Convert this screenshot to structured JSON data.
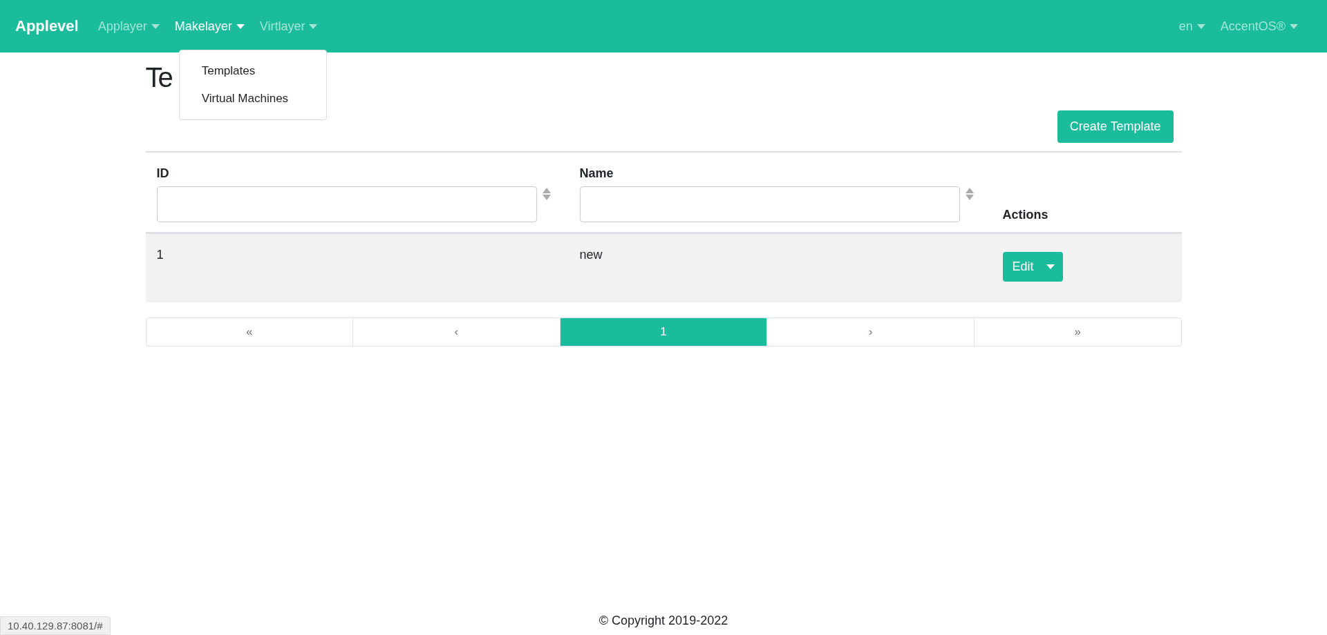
{
  "navbar": {
    "brand": "Applevel",
    "menus": [
      {
        "label": "Applayer",
        "expanded": false
      },
      {
        "label": "Makelayer",
        "expanded": true
      },
      {
        "label": "Virtlayer",
        "expanded": false
      }
    ],
    "right_menus": [
      {
        "label": "en"
      },
      {
        "label": "AccentOS®"
      }
    ]
  },
  "dropdown": {
    "items": [
      "Templates",
      "Virtual Machines"
    ]
  },
  "page_title": "Te",
  "create_button": "Create Template",
  "table": {
    "columns": [
      {
        "label": "ID",
        "kind": "filter"
      },
      {
        "label": "Name",
        "kind": "filter"
      },
      {
        "label": "Actions",
        "kind": "plain"
      }
    ],
    "rows": [
      {
        "id": "1",
        "name": "new",
        "action": "Edit"
      }
    ]
  },
  "pagination": [
    {
      "label": "«",
      "selected": false
    },
    {
      "label": "‹",
      "selected": false
    },
    {
      "label": "1",
      "selected": true
    },
    {
      "label": "›",
      "selected": false
    },
    {
      "label": "»",
      "selected": false
    }
  ],
  "footer": "© Copyright 2019-2022",
  "status_url": "10.40.129.87:8081/#"
}
